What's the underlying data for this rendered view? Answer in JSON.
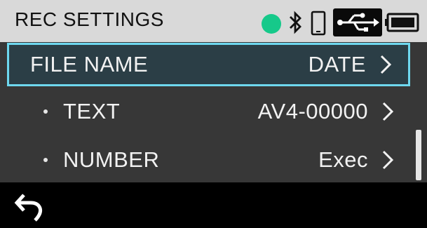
{
  "header": {
    "title": "REC SETTINGS",
    "status_color": "#16c98a",
    "icons": [
      "status-dot-icon",
      "bluetooth-icon",
      "phone-icon",
      "usb-icon",
      "battery-icon"
    ]
  },
  "list": {
    "items": [
      {
        "label": "FILE NAME",
        "value": "DATE",
        "selected": true,
        "sub": false
      },
      {
        "label": "TEXT",
        "value": "AV4-00000",
        "selected": false,
        "sub": true
      },
      {
        "label": "NUMBER",
        "value": "Exec",
        "selected": false,
        "sub": true
      }
    ],
    "highlight_color": "#6ed8ef"
  },
  "footer": {
    "icons": [
      "back-arrow-icon"
    ]
  }
}
